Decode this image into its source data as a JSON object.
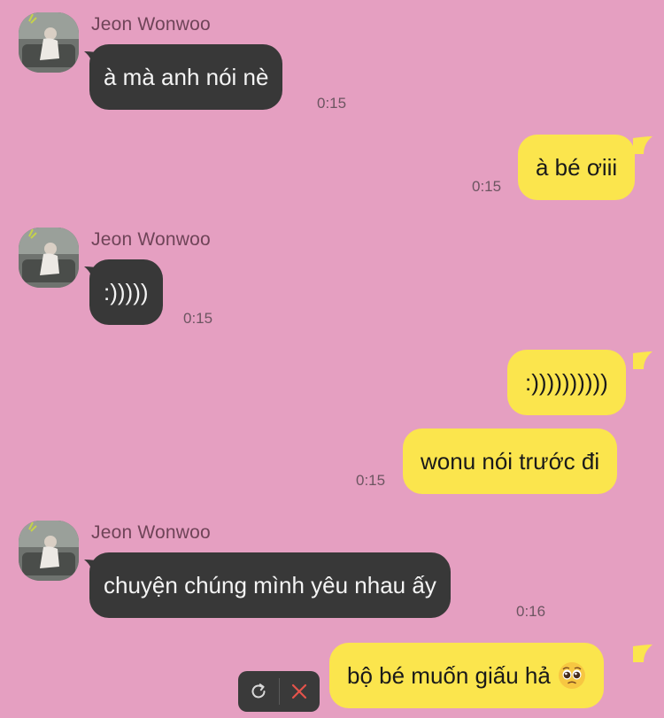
{
  "messages": [
    {
      "sender": "Jeon Wonwoo",
      "text": "à mà anh nói nè",
      "time": "0:15"
    },
    {
      "text": "à bé ơiii",
      "time": "0:15"
    },
    {
      "sender": "Jeon Wonwoo",
      "text": ":)))))",
      "time": "0:15"
    },
    {
      "text": ":))))))))))"
    },
    {
      "text": "wonu nói trước đi",
      "time": "0:15"
    },
    {
      "sender": "Jeon Wonwoo",
      "text": "chuyện chúng mình yêu nhau ấy",
      "time": "0:16"
    },
    {
      "text": "bộ bé muốn giấu hả",
      "emoji": "pleading-face-emoji"
    }
  ],
  "colors": {
    "background": "#e59fc1",
    "incoming_bubble": "#383838",
    "outgoing_bubble": "#fbe54d",
    "retry_icon": "#d9d9d9",
    "delete_icon": "#e5534b"
  },
  "icons": {
    "retry": "refresh-icon",
    "delete": "close-icon"
  }
}
